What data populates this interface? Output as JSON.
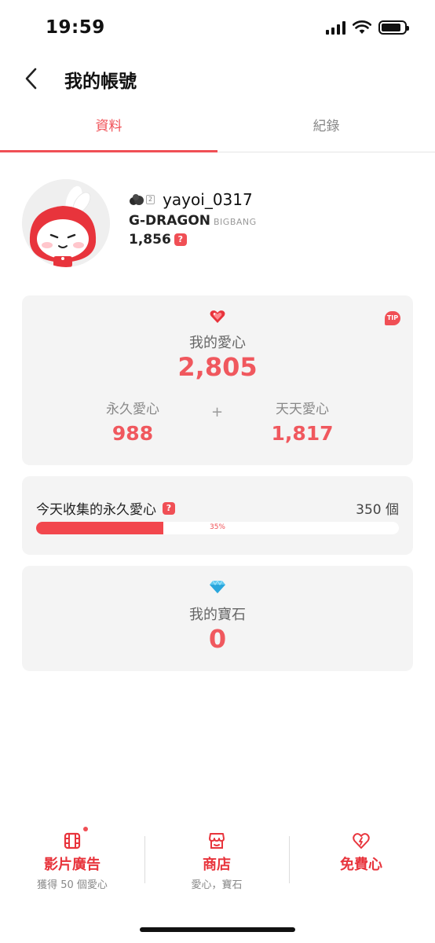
{
  "status_bar": {
    "time": "19:59"
  },
  "header": {
    "title": "我的帳號"
  },
  "tabs": [
    {
      "label": "資料",
      "active": true
    },
    {
      "label": "紀錄",
      "active": false
    }
  ],
  "profile": {
    "rank_level": "2",
    "username": "yayoi_0317",
    "artist": "G-DRAGON",
    "group": "BIGBANG",
    "points": "1,856",
    "help_icon": "?"
  },
  "hearts_card": {
    "icon": "heart-gem-icon",
    "tip_label": "TIP",
    "title": "我的愛心",
    "total": "2,805",
    "permanent_label": "永久愛心",
    "permanent_value": "988",
    "plus": "+",
    "daily_label": "天天愛心",
    "daily_value": "1,817"
  },
  "daily_collect": {
    "label": "今天收集的永久愛心",
    "help_icon": "?",
    "count": "350 個",
    "progress_text": "35%",
    "progress": 0.35
  },
  "gems_card": {
    "icon": "diamond-icon",
    "title": "我的寶石",
    "value": "0"
  },
  "bottom_nav": [
    {
      "icon": "film-icon",
      "label": "影片廣告",
      "sub": "獲得 50 個愛心",
      "has_dot": true
    },
    {
      "icon": "shop-icon",
      "label": "商店",
      "sub": "愛心，寶石",
      "has_dot": false
    },
    {
      "icon": "heart-bolt-icon",
      "label": "免費心",
      "sub": "",
      "has_dot": false
    }
  ],
  "colors": {
    "accent": "#f04f55",
    "value_red": "#f0585e",
    "card_bg": "#f4f4f4"
  }
}
